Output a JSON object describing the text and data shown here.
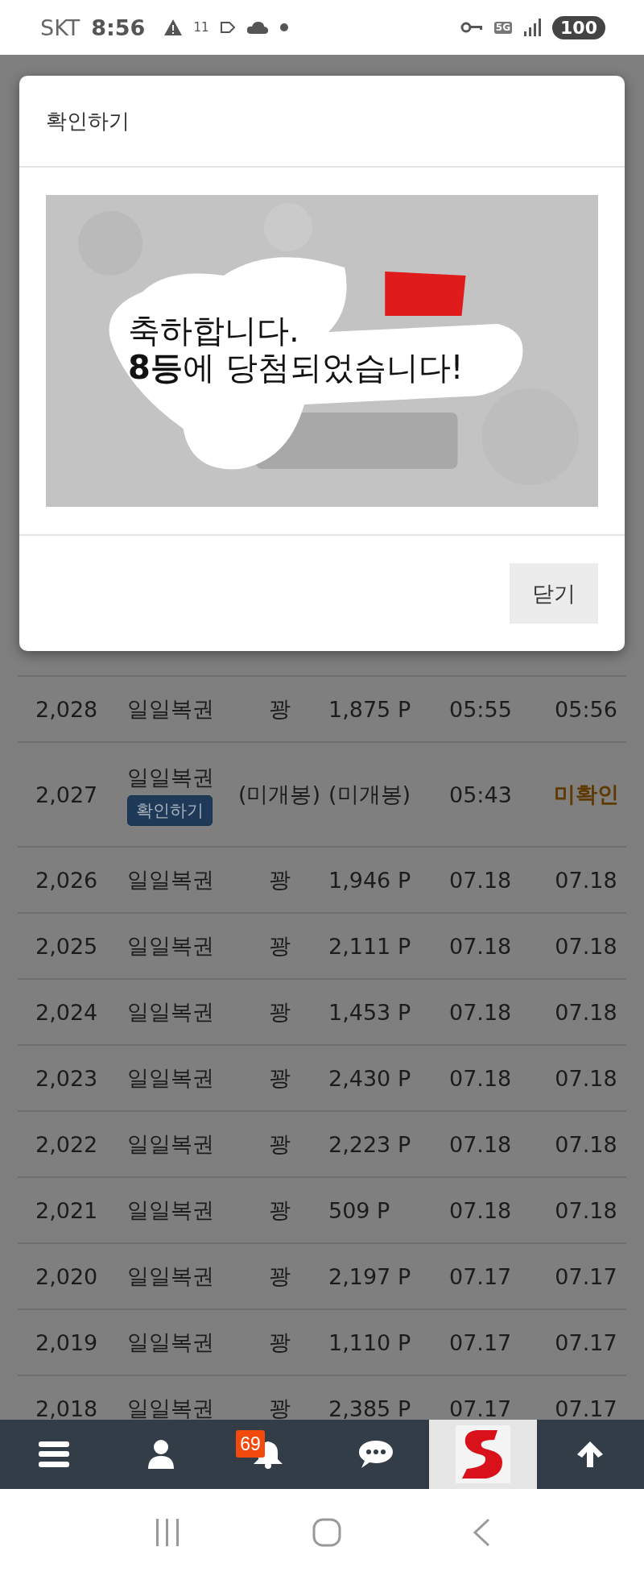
{
  "status_bar": {
    "carrier": "SKT",
    "time": "8:56",
    "notification_count": "11",
    "network": "5G",
    "battery": "100"
  },
  "dialog": {
    "title": "확인하기",
    "message_lines": [
      "축하합니다.",
      "**8등**에 당첨되었습니다!"
    ],
    "close_button": "닫기"
  },
  "table": {
    "rows": [
      {
        "no": "2,028",
        "name": "일일복권",
        "result": "꽝",
        "points": "1,875 P",
        "opened": "05:55",
        "checked": "05:56",
        "pending": false
      },
      {
        "no": "2,027",
        "name": "일일복권",
        "button": "확인하기",
        "result": "(미개봉)",
        "points": "(미개봉)",
        "opened": "05:43",
        "checked": "미확인",
        "pending": true
      },
      {
        "no": "2,026",
        "name": "일일복권",
        "result": "꽝",
        "points": "1,946 P",
        "opened": "07.18",
        "checked": "07.18",
        "pending": false
      },
      {
        "no": "2,025",
        "name": "일일복권",
        "result": "꽝",
        "points": "2,111 P",
        "opened": "07.18",
        "checked": "07.18",
        "pending": false
      },
      {
        "no": "2,024",
        "name": "일일복권",
        "result": "꽝",
        "points": "1,453 P",
        "opened": "07.18",
        "checked": "07.18",
        "pending": false
      },
      {
        "no": "2,023",
        "name": "일일복권",
        "result": "꽝",
        "points": "2,430 P",
        "opened": "07.18",
        "checked": "07.18",
        "pending": false
      },
      {
        "no": "2,022",
        "name": "일일복권",
        "result": "꽝",
        "points": "2,223 P",
        "opened": "07.18",
        "checked": "07.18",
        "pending": false
      },
      {
        "no": "2,021",
        "name": "일일복권",
        "result": "꽝",
        "points": "509 P",
        "opened": "07.18",
        "checked": "07.18",
        "pending": false
      },
      {
        "no": "2,020",
        "name": "일일복권",
        "result": "꽝",
        "points": "2,197 P",
        "opened": "07.17",
        "checked": "07.17",
        "pending": false
      },
      {
        "no": "2,019",
        "name": "일일복권",
        "result": "꽝",
        "points": "1,110 P",
        "opened": "07.17",
        "checked": "07.17",
        "pending": false
      },
      {
        "no": "2,018",
        "name": "일일복권",
        "result": "꽝",
        "points": "2,385 P",
        "opened": "07.17",
        "checked": "07.17",
        "pending": false
      }
    ]
  },
  "bottom_nav": [
    {
      "kind": "menu"
    },
    {
      "kind": "user"
    },
    {
      "kind": "bell",
      "badge": "69"
    },
    {
      "kind": "chat"
    },
    {
      "kind": "logo"
    },
    {
      "kind": "up"
    }
  ]
}
